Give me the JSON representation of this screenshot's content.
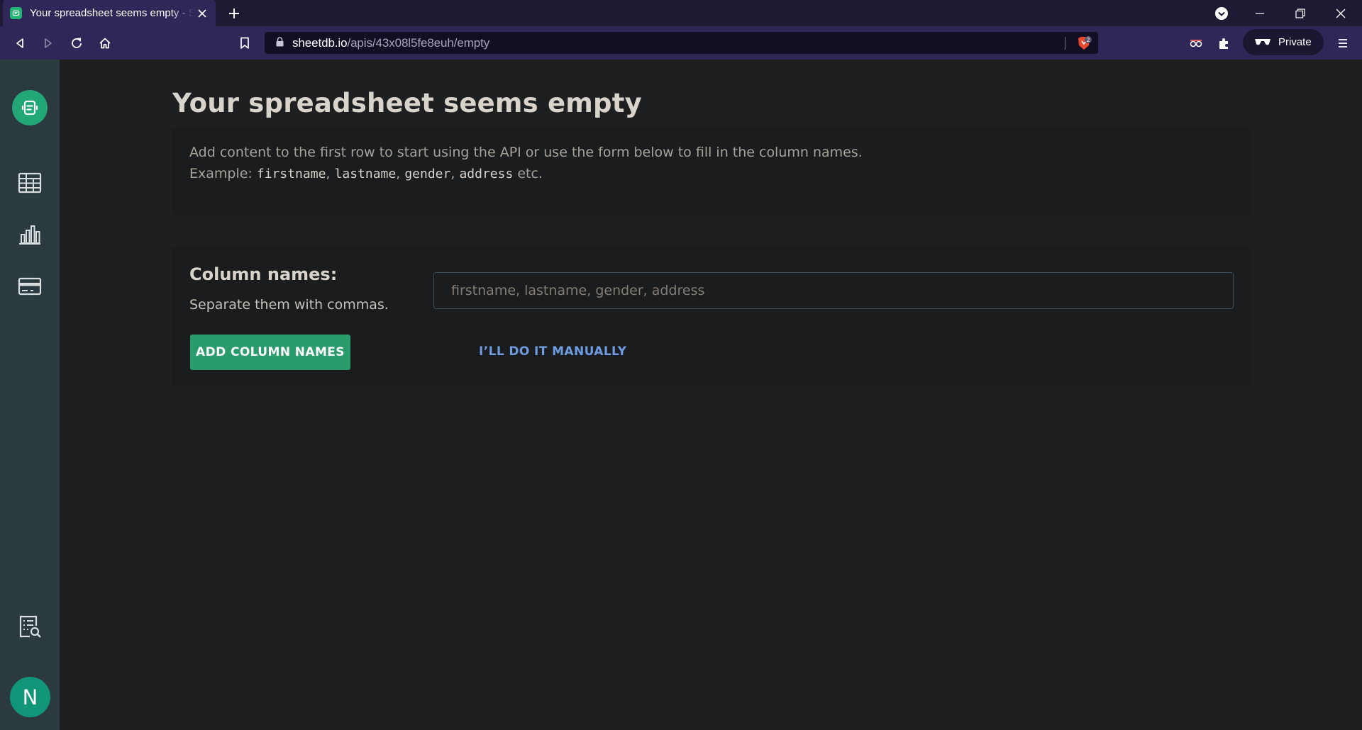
{
  "browser": {
    "tab_title": "Your spreadsheet seems empty - SheetDB",
    "url_domain": "sheetdb.io",
    "url_path": "/apis/43x08l5fe8euh/empty",
    "shield_count": "2",
    "private_label": "Private"
  },
  "sidebar": {
    "items": [
      {
        "name": "sheets",
        "icon": "table-icon"
      },
      {
        "name": "stats",
        "icon": "bar-chart-icon"
      },
      {
        "name": "billing",
        "icon": "credit-card-icon"
      },
      {
        "name": "logs",
        "icon": "document-search-icon"
      }
    ],
    "avatar_initial": "N"
  },
  "main": {
    "title": "Your spreadsheet seems empty",
    "info": {
      "line1": "Add content to the first row to start using the API or use the form below to fill in the column names.",
      "example_prefix": "Example: ",
      "example_fields": [
        "firstname",
        "lastname",
        "gender",
        "address"
      ],
      "example_suffix": " etc."
    },
    "form": {
      "label": "Column names:",
      "help": "Separate them with commas.",
      "input_placeholder": "firstname, lastname, gender, address",
      "input_value": "",
      "add_button": "ADD COLUMN NAMES",
      "manual_link": "I’LL DO IT MANUALLY"
    }
  },
  "colors": {
    "accent_green": "#2a9c6c",
    "link_blue": "#6f9ce0",
    "browser_purple": "#2f2757",
    "sidebar_bg": "#2a3a3f"
  }
}
